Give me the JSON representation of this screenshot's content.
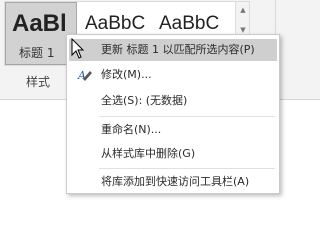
{
  "styles_gallery": {
    "tiles": [
      {
        "sample": "AaBl",
        "label": "标题 1"
      },
      {
        "sample": "AaBbC",
        "label": ""
      },
      {
        "sample": "AaBbC",
        "label": ""
      }
    ],
    "scroll_up": "▲",
    "scroll_down": "▼"
  },
  "ribbon": {
    "group_label": "样式"
  },
  "context_menu": {
    "items": [
      {
        "label": "更新 标题 1 以匹配所选内容(P)",
        "highlighted": true
      },
      {
        "label": "修改(M)...",
        "icon": "modify-style-icon"
      },
      {
        "label": "全选(S): (无数据)"
      },
      {
        "label": "重命名(N)..."
      },
      {
        "label": "从样式库中删除(G)"
      },
      {
        "label": "将库添加到快速访问工具栏(A)"
      }
    ]
  },
  "colors": {
    "highlight": "#cfcfcf",
    "modify_icon": "#2b5aa0"
  }
}
